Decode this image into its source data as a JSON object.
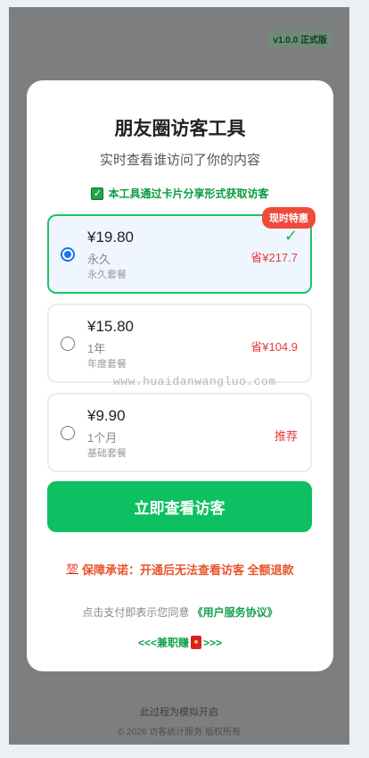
{
  "version_badge": "v1.0.0 正式版",
  "title": "朋友圈访客工具",
  "subtitle": "实时查看谁访问了你的内容",
  "notice": "本工具通过卡片分享形式获取访客",
  "plans": [
    {
      "price": "¥19.80",
      "period": "永久",
      "desc": "永久套餐",
      "tag": "省¥217.7",
      "badge": "现时特惠",
      "selected": true
    },
    {
      "price": "¥15.80",
      "period": "1年",
      "desc": "年度套餐",
      "tag": "省¥104.9",
      "selected": false
    },
    {
      "price": "¥9.90",
      "period": "1个月",
      "desc": "基础套餐",
      "tag": "推荐",
      "selected": false
    }
  ],
  "cta_label": "立即查看访客",
  "guarantee": "保障承诺：开通后无法查看访客 全额退款",
  "agreement_prefix": "点击支付即表示您同意",
  "agreement_link": "《用户服务协议》",
  "parttime_prefix": "<<<兼职赚",
  "parttime_suffix": ">>>",
  "watermark": "www.huaidanwangluo.com",
  "footer_line1": "此过程为模拟开启",
  "footer_line2": "© 2026 访客统计服务 版权所有",
  "colors": {
    "accent_green": "#0dc061",
    "selected_border": "#1ec462",
    "radio_blue": "#1a73e8",
    "save_red": "#e23b3b"
  }
}
